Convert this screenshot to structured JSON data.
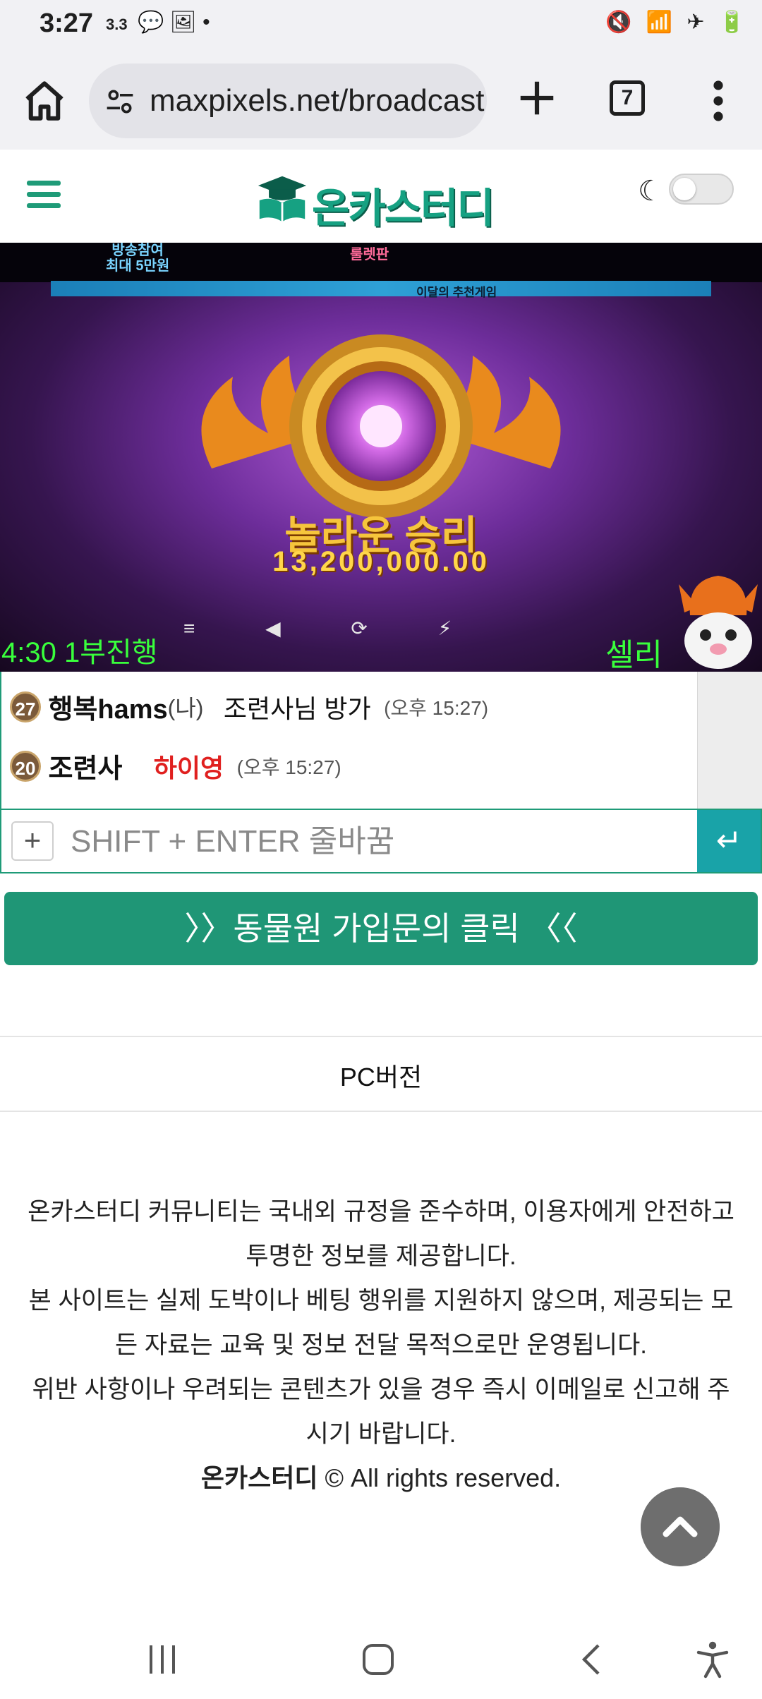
{
  "status": {
    "time": "3:27",
    "net_speed": "3.3",
    "left_icons": "💬 🖼 •",
    "right_icons": "🔇 📶 ✈ 🔋"
  },
  "browser": {
    "url": "maxpixels.net/broadcast",
    "tab_count": "7"
  },
  "header": {
    "logo_text": "온카스터디"
  },
  "video": {
    "promo_left_1": "방송참여",
    "promo_left_2": "최대 5만원",
    "promo_mid": "룰렛판",
    "banner_text": "이달의 추천게임",
    "win_label": "놀라운 승리",
    "win_amount": "13,200,000.00",
    "overlay_time": "4:30 1부진행",
    "overlay_name": "셀리"
  },
  "chat": {
    "messages": [
      {
        "level": "27",
        "nick": "행복hams",
        "me_tag": "(나)",
        "text": "조련사님 방가",
        "time": "(오후 15:27)"
      },
      {
        "level": "20",
        "nick": "조련사",
        "text": "하이영",
        "time": "(오후 15:27)"
      }
    ],
    "plus_label": "+",
    "input_placeholder": "SHIFT + ENTER 줄바꿈",
    "send_label": "↵"
  },
  "cta": {
    "label": "〉〉동물원 가입문의 클릭 〈〈"
  },
  "footer": {
    "pc_version": "PC버전",
    "disclaimer_1": "온카스터디 커뮤니티는 국내외 규정을 준수하며, 이용자에게 안전하고 투명한 정보를 제공합니다.",
    "disclaimer_2": "본 사이트는 실제 도박이나 베팅 행위를 지원하지 않으며, 제공되는 모든 자료는 교육 및 정보 전달 목적으로만 운영됩니다.",
    "disclaimer_3": "위반 사항이나 우려되는 콘텐츠가 있을 경우 즉시 이메일로 신고해 주시기 바랍니다.",
    "copyright_brand": "온카스터디",
    "copyright_text": "© All rights reserved."
  }
}
